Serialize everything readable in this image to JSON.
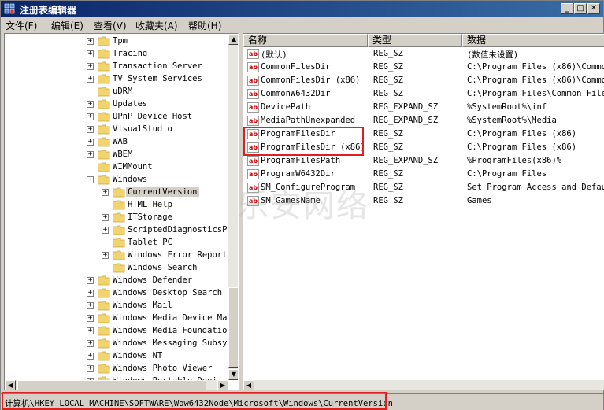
{
  "window": {
    "title": "注册表编辑器"
  },
  "menu": [
    "文件(F)",
    "编辑(E)",
    "查看(V)",
    "收藏夹(A)",
    "帮助(H)"
  ],
  "tree": [
    {
      "label": "Tpm",
      "depth": 0,
      "expander": "+"
    },
    {
      "label": "Tracing",
      "depth": 0,
      "expander": "+"
    },
    {
      "label": "Transaction Server",
      "depth": 0,
      "expander": "+"
    },
    {
      "label": "TV System Services",
      "depth": 0,
      "expander": "+"
    },
    {
      "label": "uDRM",
      "depth": 0,
      "expander": ""
    },
    {
      "label": "Updates",
      "depth": 0,
      "expander": "+"
    },
    {
      "label": "UPnP Device Host",
      "depth": 0,
      "expander": "+"
    },
    {
      "label": "VisualStudio",
      "depth": 0,
      "expander": "+"
    },
    {
      "label": "WAB",
      "depth": 0,
      "expander": "+"
    },
    {
      "label": "WBEM",
      "depth": 0,
      "expander": "+"
    },
    {
      "label": "WIMMount",
      "depth": 0,
      "expander": ""
    },
    {
      "label": "Windows",
      "depth": 0,
      "expander": "-"
    },
    {
      "label": "CurrentVersion",
      "depth": 1,
      "expander": "+",
      "selected": true
    },
    {
      "label": "HTML Help",
      "depth": 1,
      "expander": ""
    },
    {
      "label": "ITStorage",
      "depth": 1,
      "expander": "+"
    },
    {
      "label": "ScriptedDiagnosticsPr",
      "depth": 1,
      "expander": "+"
    },
    {
      "label": "Tablet PC",
      "depth": 1,
      "expander": ""
    },
    {
      "label": "Windows Error Report",
      "depth": 1,
      "expander": "+"
    },
    {
      "label": "Windows Search",
      "depth": 1,
      "expander": ""
    },
    {
      "label": "Windows Defender",
      "depth": 0,
      "expander": "+"
    },
    {
      "label": "Windows Desktop Search",
      "depth": 0,
      "expander": "+"
    },
    {
      "label": "Windows Mail",
      "depth": 0,
      "expander": "+"
    },
    {
      "label": "Windows Media Device Man",
      "depth": 0,
      "expander": "+"
    },
    {
      "label": "Windows Media Foundation",
      "depth": 0,
      "expander": "+"
    },
    {
      "label": "Windows Messaging Subsys",
      "depth": 0,
      "expander": "+"
    },
    {
      "label": "Windows NT",
      "depth": 0,
      "expander": "+"
    },
    {
      "label": "Windows Photo Viewer",
      "depth": 0,
      "expander": "+"
    },
    {
      "label": "Windows Portable Devi",
      "depth": 0,
      "expander": "+"
    }
  ],
  "columns": {
    "name": "名称",
    "type": "类型",
    "data": "数据"
  },
  "values": [
    {
      "name": "(默认)",
      "type": "REG_SZ",
      "data": "(数值未设置)"
    },
    {
      "name": "CommonFilesDir",
      "type": "REG_SZ",
      "data": "C:\\Program Files (x86)\\Common"
    },
    {
      "name": "CommonFilesDir (x86)",
      "type": "REG_SZ",
      "data": "C:\\Program Files (x86)\\Common"
    },
    {
      "name": "CommonW6432Dir",
      "type": "REG_SZ",
      "data": "C:\\Program Files\\Common Files"
    },
    {
      "name": "DevicePath",
      "type": "REG_EXPAND_SZ",
      "data": "%SystemRoot%\\inf"
    },
    {
      "name": "MediaPathUnexpanded",
      "type": "REG_EXPAND_SZ",
      "data": "%SystemRoot%\\Media"
    },
    {
      "name": "ProgramFilesDir",
      "type": "REG_SZ",
      "data": "C:\\Program Files (x86)"
    },
    {
      "name": "ProgramFilesDir (x86)",
      "type": "REG_SZ",
      "data": "C:\\Program Files (x86)"
    },
    {
      "name": "ProgramFilesPath",
      "type": "REG_EXPAND_SZ",
      "data": "%ProgramFiles(x86)%"
    },
    {
      "name": "ProgramW6432Dir",
      "type": "REG_SZ",
      "data": "C:\\Program Files"
    },
    {
      "name": "SM_ConfigureProgram",
      "type": "REG_SZ",
      "data": "Set Program Access and Defaul"
    },
    {
      "name": "SM_GamesName",
      "type": "REG_SZ",
      "data": "Games"
    }
  ],
  "status": {
    "path": "计算机\\HKEY_LOCAL_MACHINE\\SOFTWARE\\Wow6432Node\\Microsoft\\Windows\\CurrentVersion"
  },
  "watermark": "乐安网络"
}
